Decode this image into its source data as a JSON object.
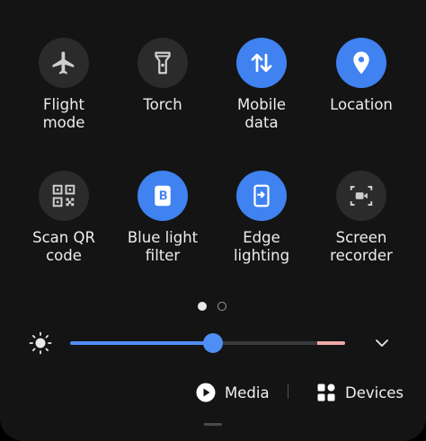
{
  "tiles": [
    {
      "label": "Flight\nmode",
      "icon": "airplane-icon",
      "active": false
    },
    {
      "label": "Torch",
      "icon": "torch-icon",
      "active": false
    },
    {
      "label": "Mobile\ndata",
      "icon": "mobile-data-icon",
      "active": true
    },
    {
      "label": "Location",
      "icon": "location-pin-icon",
      "active": true
    },
    {
      "label": "Scan QR\ncode",
      "icon": "qr-code-icon",
      "active": false
    },
    {
      "label": "Blue light\nfilter",
      "icon": "blue-light-filter-icon",
      "active": true
    },
    {
      "label": "Edge\nlighting",
      "icon": "edge-lighting-icon",
      "active": true
    },
    {
      "label": "Screen\nrecorder",
      "icon": "screen-recorder-icon",
      "active": false
    }
  ],
  "pager": {
    "current_page": 1,
    "total_pages": 2
  },
  "brightness": {
    "level": 0.52,
    "warn_from": 0.9,
    "icon": "brightness-icon"
  },
  "media_button": {
    "label": "Media",
    "icon": "play-icon"
  },
  "devices_button": {
    "label": "Devices",
    "icon": "devices-grid-icon"
  },
  "colors": {
    "active_tile": "#3f82f0",
    "inactive_tile": "#2b2b2b",
    "slider_accent": "#4f8ef5"
  }
}
